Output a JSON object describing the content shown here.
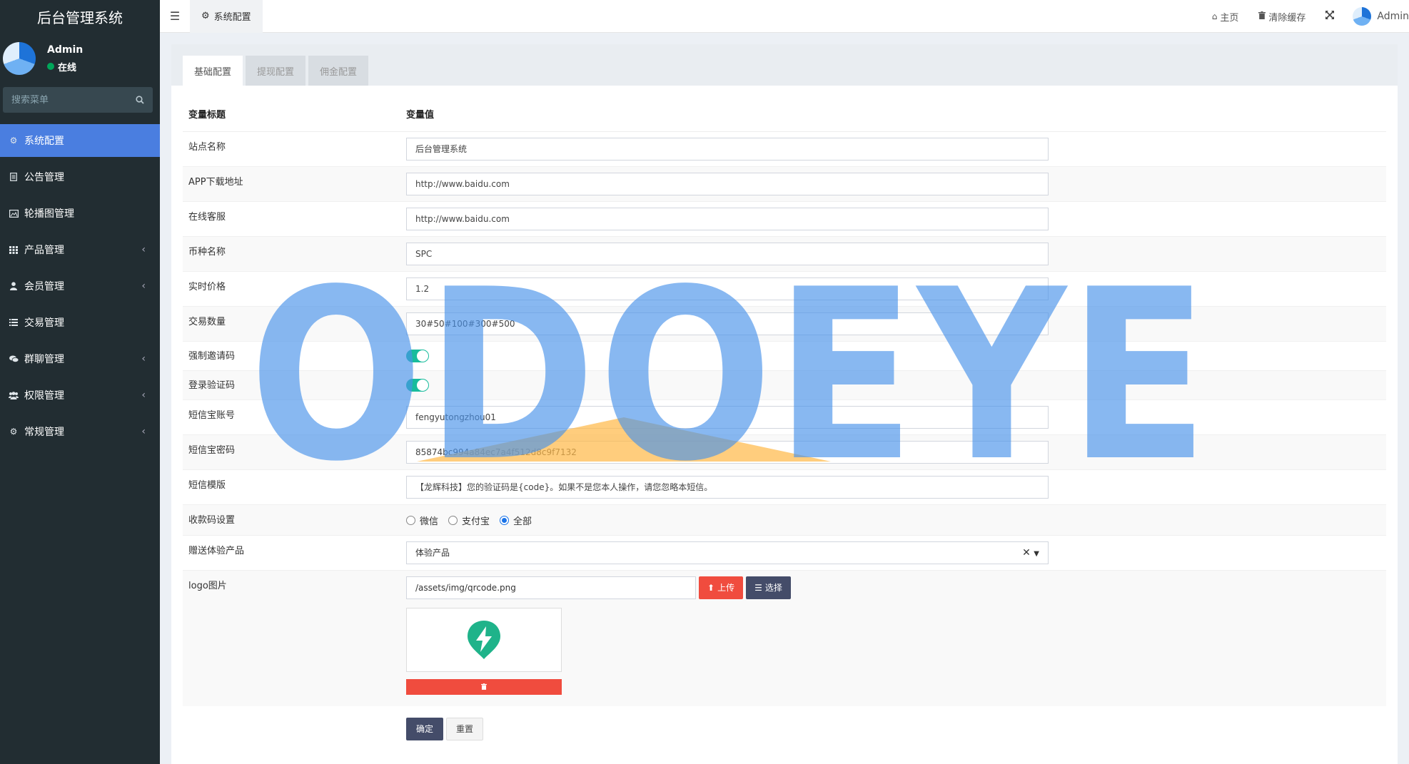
{
  "app": {
    "title": "后台管理系统"
  },
  "user": {
    "name": "Admin",
    "status": "在线"
  },
  "search": {
    "placeholder": "搜索菜单"
  },
  "menu": [
    {
      "label": "系统配置",
      "icon": "gear-icon",
      "active": true,
      "chevron": false
    },
    {
      "label": "公告管理",
      "icon": "file-icon",
      "chevron": false
    },
    {
      "label": "轮播图管理",
      "icon": "image-icon",
      "chevron": false
    },
    {
      "label": "产品管理",
      "icon": "grid-icon",
      "chevron": true
    },
    {
      "label": "会员管理",
      "icon": "user-icon",
      "chevron": true
    },
    {
      "label": "交易管理",
      "icon": "list-icon",
      "chevron": false
    },
    {
      "label": "群聊管理",
      "icon": "comments-icon",
      "chevron": true
    },
    {
      "label": "权限管理",
      "icon": "group-icon",
      "chevron": true
    },
    {
      "label": "常规管理",
      "icon": "cogs-icon",
      "chevron": true
    }
  ],
  "topbar": {
    "tab": "系统配置",
    "home": "主页",
    "clear_cache": "清除缓存",
    "user": "Admin"
  },
  "tabs": [
    "基础配置",
    "提现配置",
    "佣金配置"
  ],
  "table": {
    "col_title": "变量标题",
    "col_value": "变量值",
    "rows": {
      "site_name": {
        "label": "站点名称",
        "value": "后台管理系统"
      },
      "app_url": {
        "label": "APP下载地址",
        "value": "http://www.baidu.com"
      },
      "service": {
        "label": "在线客服",
        "value": "http://www.baidu.com"
      },
      "coin": {
        "label": "币种名称",
        "value": "SPC"
      },
      "price": {
        "label": "实时价格",
        "value": "1.2"
      },
      "trade_qty": {
        "label": "交易数量",
        "value": "30#50#100#300#500"
      },
      "invite": {
        "label": "强制邀请码"
      },
      "login_code": {
        "label": "登录验证码"
      },
      "sms_account": {
        "label": "短信宝账号",
        "value": "fengyutongzhou01"
      },
      "sms_password": {
        "label": "短信宝密码",
        "value": "85874bc994a84ec7a4f512d8c9f7132"
      },
      "sms_template": {
        "label": "短信模版",
        "value": "【龙辉科技】您的验证码是{code}。如果不是您本人操作，请您忽略本短信。"
      },
      "qrcode": {
        "label": "收款码设置",
        "options": [
          "微信",
          "支付宝",
          "全部"
        ],
        "selected": "全部"
      },
      "gift": {
        "label": "赠送体验产品",
        "value": "体验产品"
      },
      "logo": {
        "label": "logo图片",
        "value": "/assets/img/qrcode.png",
        "upload": "上传",
        "choose": "选择"
      }
    }
  },
  "actions": {
    "confirm": "确定",
    "reset": "重置"
  },
  "watermark": {
    "text": "ODOEYE"
  },
  "colors": {
    "sidebar": "#222d32",
    "active": "#4a7ee0",
    "switch": "#18bc9c",
    "danger": "#f04c3e",
    "primary": "#444c69"
  }
}
